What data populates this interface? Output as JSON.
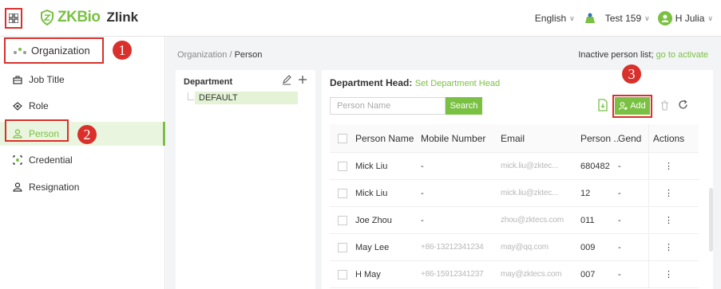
{
  "header": {
    "logo_main": "ZKBio",
    "logo_sub": "Zlink",
    "language": "English",
    "tenant": "Test 159",
    "user": "H Julia"
  },
  "sidebar": {
    "org_label": "Organization",
    "items": [
      {
        "label": "Job Title",
        "icon": "briefcase-icon"
      },
      {
        "label": "Role",
        "icon": "role-icon"
      },
      {
        "label": "Person",
        "icon": "person-icon"
      },
      {
        "label": "Credential",
        "icon": "credential-icon"
      },
      {
        "label": "Resignation",
        "icon": "resignation-icon"
      }
    ]
  },
  "badges": [
    "1",
    "2",
    "3"
  ],
  "breadcrumb": {
    "parent": "Organization",
    "sep": "/",
    "current": "Person"
  },
  "inactive": {
    "text": "Inactive person list;",
    "link": "go to activate"
  },
  "department": {
    "title": "Department",
    "node": "DEFAULT"
  },
  "person_panel": {
    "head_label": "Department Head:",
    "head_link": "Set Department Head",
    "search_placeholder": "Person Name",
    "search_btn": "Search",
    "add_btn": "Add"
  },
  "table": {
    "headers": [
      "Person Name",
      "Mobile Number",
      "Email",
      "Person ...",
      "Gend",
      "Actions"
    ],
    "rows": [
      {
        "name": "Mick Liu",
        "mobile": "-",
        "email": "mick.liu@zktec...",
        "pid": "680482",
        "gender": "-",
        "action": "⋮"
      },
      {
        "name": "Mick Liu",
        "mobile": "-",
        "email": "mick.liu@zktec...",
        "pid": "12",
        "gender": "-",
        "action": "⋮"
      },
      {
        "name": "Joe Zhou",
        "mobile": "-",
        "email": "zhou@zktecs.com",
        "pid": "011",
        "gender": "-",
        "action": "⋮"
      },
      {
        "name": "May Lee",
        "mobile": "+86-13212341234",
        "email": "may@qq.com",
        "pid": "009",
        "gender": "-",
        "action": "⋮"
      },
      {
        "name": "H May",
        "mobile": "+86-15912341237",
        "email": "may@zktecs.com",
        "pid": "007",
        "gender": "-",
        "action": "⋮"
      }
    ]
  },
  "colors": {
    "accent": "#7ac143",
    "highlight": "#d9302b"
  }
}
